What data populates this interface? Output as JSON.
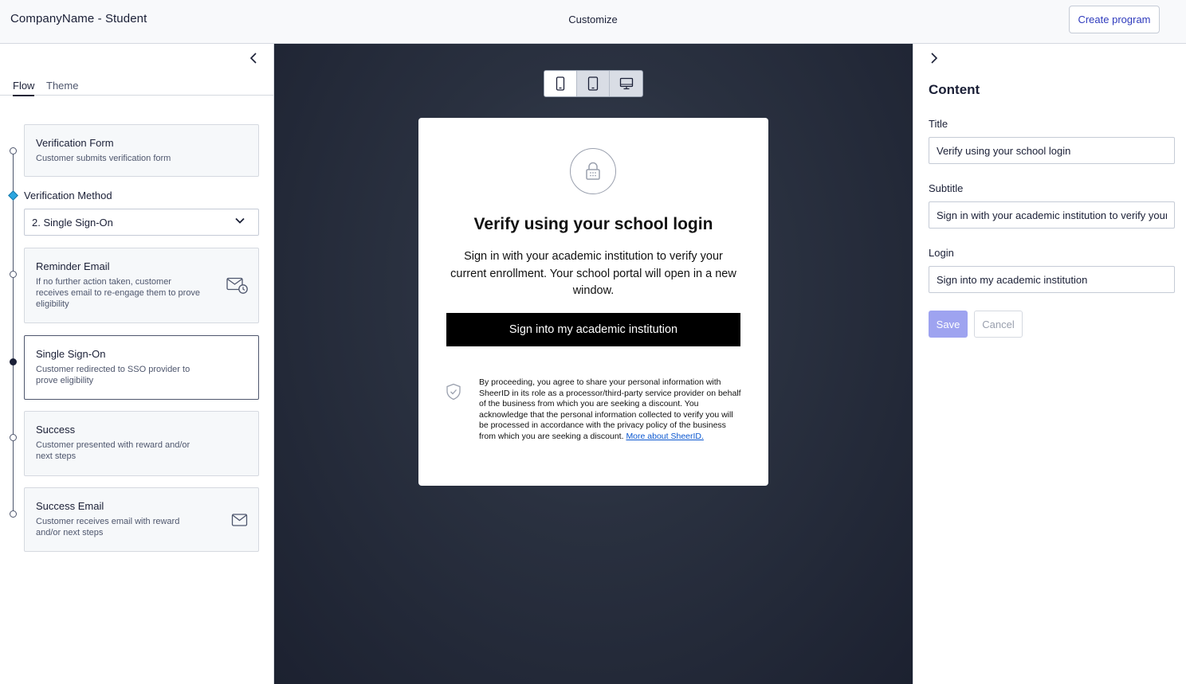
{
  "header": {
    "app_title": "CompanyName - Student",
    "center_title": "Customize",
    "create_button": "Create program"
  },
  "left_panel": {
    "tabs": [
      {
        "label": "Flow",
        "active": true
      },
      {
        "label": "Theme",
        "active": false
      }
    ],
    "steps": {
      "verification_form": {
        "title": "Verification Form",
        "desc": "Customer submits verification form"
      },
      "verification_method": {
        "label": "Verification Method",
        "selected": "2. Single Sign-On"
      },
      "reminder_email": {
        "title": "Reminder Email",
        "desc": "If no further action taken, customer receives email to re-engage them to prove eligibility",
        "icon": "email-clock-icon"
      },
      "single_sign_on": {
        "title": "Single Sign-On",
        "desc": "Customer redirected to SSO provider to prove eligibility",
        "selected": true
      },
      "success": {
        "title": "Success",
        "desc": "Customer presented with reward and/or next steps"
      },
      "success_email": {
        "title": "Success Email",
        "desc": "Customer receives email with reward and/or next steps",
        "icon": "envelope-icon"
      }
    }
  },
  "preview": {
    "device_modes": [
      "mobile-icon",
      "tablet-icon",
      "desktop-icon"
    ],
    "active_device": "mobile",
    "form": {
      "title": "Verify using your school login",
      "subtitle": "Sign in with your academic institution to verify your current enrollment. Your school portal will open in a new window.",
      "button": "Sign into my academic institution",
      "legal_text": "By proceeding, you agree to share your personal information with SheerID in its role as a processor/third-party service provider on behalf of the business from which you are seeking a discount. You acknowledge that the personal information collected to verify you will be processed in accordance with the privacy policy of the business from which you are seeking a discount. ",
      "legal_link": "More about SheerID."
    }
  },
  "right_panel": {
    "heading": "Content",
    "fields": {
      "title": {
        "label": "Title",
        "value": "Verify using your school login"
      },
      "subtitle": {
        "label": "Subtitle",
        "value": "Sign in with your academic institution to verify your current enrollment. Your school portal will open in a new window."
      },
      "login": {
        "label": "Login",
        "value": "Sign into my academic institution"
      }
    },
    "save_label": "Save",
    "cancel_label": "Cancel"
  },
  "colors": {
    "accent": "#2f3bbd",
    "save_disabled": "#9ea3f0",
    "diamond": "#2aa6e0",
    "preview_bg": "#222836"
  }
}
